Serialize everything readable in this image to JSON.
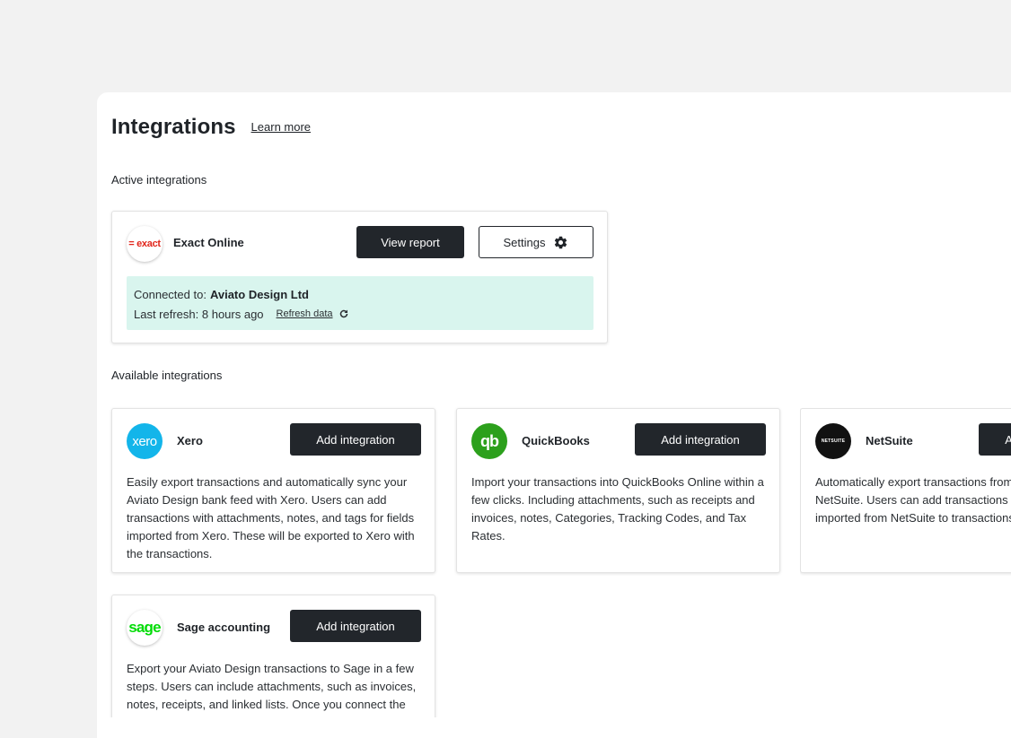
{
  "header": {
    "title": "Integrations",
    "learn_more": "Learn more"
  },
  "active_section": {
    "title": "Active integrations",
    "card": {
      "name": "Exact Online",
      "logo_text": "= exact",
      "view_report": "View report",
      "settings": "Settings",
      "connected_label": "Connected to:",
      "connected_value": "Aviato Design Ltd",
      "last_refresh": "Last refresh: 8 hours ago",
      "refresh_link": "Refresh data"
    }
  },
  "available_section": {
    "title": "Available integrations",
    "add_label": "Add integration",
    "cards": [
      {
        "name": "Xero",
        "logo_text": "xero",
        "description": "Easily export transactions and automatically sync your Aviato Design bank feed with Xero. Users can add transactions with attachments, notes, and tags for fields imported from Xero. These will be exported to Xero with the transactions."
      },
      {
        "name": "QuickBooks",
        "logo_text": "qb",
        "description": "Import your transactions into QuickBooks Online within a few clicks. Including attachments, such as receipts and invoices, notes, Categories, Tracking Codes, and Tax Rates."
      },
      {
        "name": "NetSuite",
        "logo_text": "NETSUITE",
        "description": "Automatically export transactions from Aviato Design to NetSuite. Users can add transactions and custom fields imported from NetSuite to transactions."
      },
      {
        "name": "Sage accounting",
        "logo_text": "sage",
        "description": "Export your Aviato Design transactions to Sage in a few steps. Users can include attachments, such as invoices, notes, receipts, and linked lists. Once you connect the integration, your Aviato Design bank feed will sync with Sage."
      }
    ]
  },
  "colors": {
    "dark_button": "#22262b",
    "status_bg": "#d9f5ee",
    "xero": "#13b5ea",
    "quickbooks": "#2ca01c",
    "sage": "#00dc06",
    "exact": "#e1251b"
  }
}
